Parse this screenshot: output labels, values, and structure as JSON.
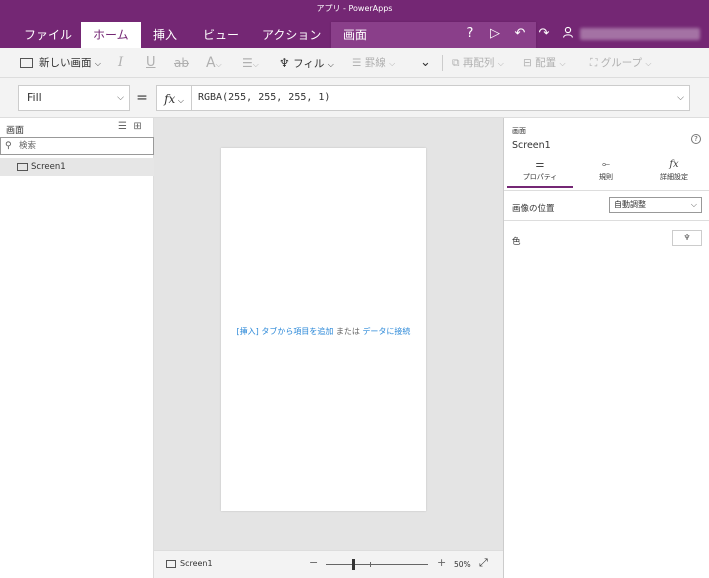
{
  "window": {
    "title": "アプリ - PowerApps"
  },
  "menu": {
    "tabs": [
      {
        "label": "ファイル"
      },
      {
        "label": "ホーム"
      },
      {
        "label": "挿入"
      },
      {
        "label": "ビュー"
      },
      {
        "label": "アクション"
      },
      {
        "label": "画面"
      }
    ],
    "active_tab": "ホーム",
    "icons": [
      "help-icon",
      "play-icon",
      "undo-icon",
      "redo-icon",
      "user-icon"
    ]
  },
  "ribbon": {
    "new_screen": "新しい画面",
    "italic": "I",
    "underline": "U",
    "strikethrough": "ab",
    "font": "A",
    "fill": "フィル",
    "border": "罫線",
    "reorder": "再配列",
    "align": "配置",
    "group": "グループ"
  },
  "formula_bar": {
    "property": "Fill",
    "equals": "=",
    "fx": "fx",
    "formula": "RGBA(255, 255, 255, 1)"
  },
  "tree": {
    "header": "画面",
    "search_placeholder": "検索",
    "items": [
      {
        "label": "Screen1"
      }
    ]
  },
  "canvas": {
    "hint_insert": "[挿入] タブから項目を追加",
    "hint_or": " または ",
    "hint_data": "データに接続"
  },
  "status": {
    "screen_name": "Screen1",
    "minus": "−",
    "plus": "+",
    "zoom": "50%",
    "zoom_level": 0.5
  },
  "properties_panel": {
    "type_label": "画面",
    "name": "Screen1",
    "help": "?",
    "tabs": [
      {
        "label": "プロパティ"
      },
      {
        "label": "規則"
      },
      {
        "label": "詳細設定"
      }
    ],
    "image_position_label": "画像の位置",
    "image_position_value": "自動調整",
    "color_label": "色"
  },
  "colors": {
    "brand": "#742774",
    "link": "#2b88d8",
    "canvas_bg": "#e4e4e4"
  }
}
